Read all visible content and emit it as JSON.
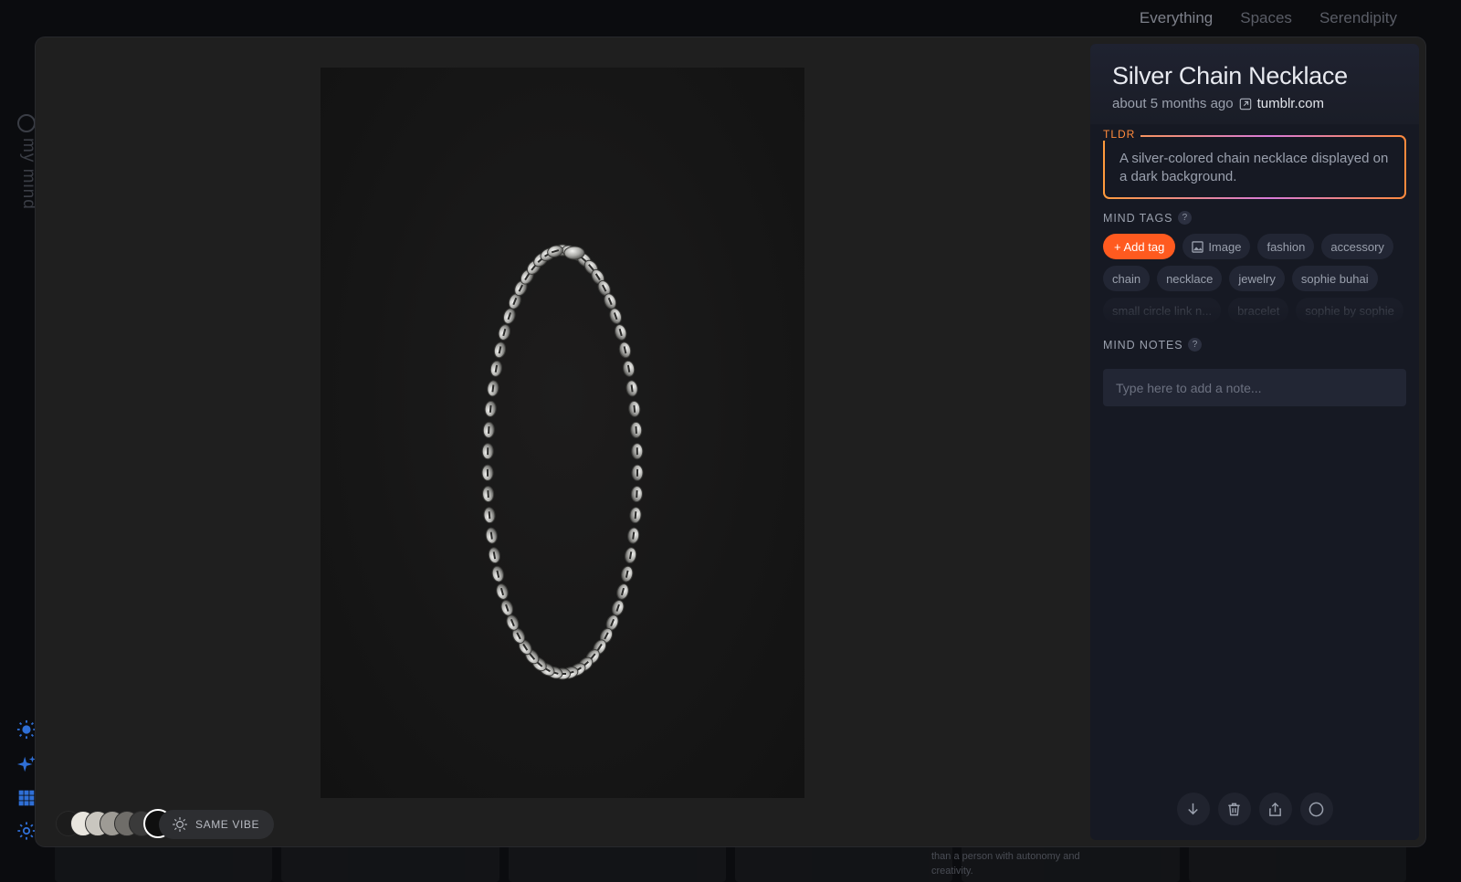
{
  "nav": {
    "items": [
      "Everything",
      "Spaces",
      "Serendipity"
    ],
    "active": "Everything"
  },
  "brand": {
    "text": "my mind"
  },
  "rail_icons": [
    "sun-icon",
    "sparkle-icon",
    "grid-icon",
    "gear-icon"
  ],
  "card": {
    "title": "Silver Chain Necklace",
    "time_ago": "about 5 months ago",
    "source": "tumblr.com",
    "tldr_label": "TLDR",
    "tldr_text": "A silver-colored chain necklace displayed on a dark background.",
    "tags_label": "MIND TAGS",
    "add_tag_label": "+ Add tag",
    "tags_row1": [
      "Image",
      "fashion",
      "accessory"
    ],
    "tags_row2": [
      "chain",
      "necklace",
      "jewelry",
      "sophie buhai"
    ],
    "tags_row3": [
      "small circle link n...",
      "bracelet",
      "sophie by sophie"
    ],
    "notes_label": "MIND NOTES",
    "notes_placeholder": "Type here to add a note...",
    "help_glyph": "?"
  },
  "palette": {
    "colors": [
      "#1c1c1c",
      "#e9e6df",
      "#c9c6bf",
      "#9e9b95",
      "#6f6d69",
      "#3a3a3a"
    ],
    "selected": "#0f0f0f"
  },
  "same_vibe_label": "SAME VIBE",
  "bottom_text": "than a person with autonomy and creativity.",
  "actions": [
    "download-icon",
    "trash-icon",
    "share-icon",
    "circle-icon"
  ],
  "colors": {
    "accent": "#ff5a1f",
    "tldr_gradient_start": "#ff9a3c",
    "tldr_gradient_mid": "#d77ad8"
  }
}
